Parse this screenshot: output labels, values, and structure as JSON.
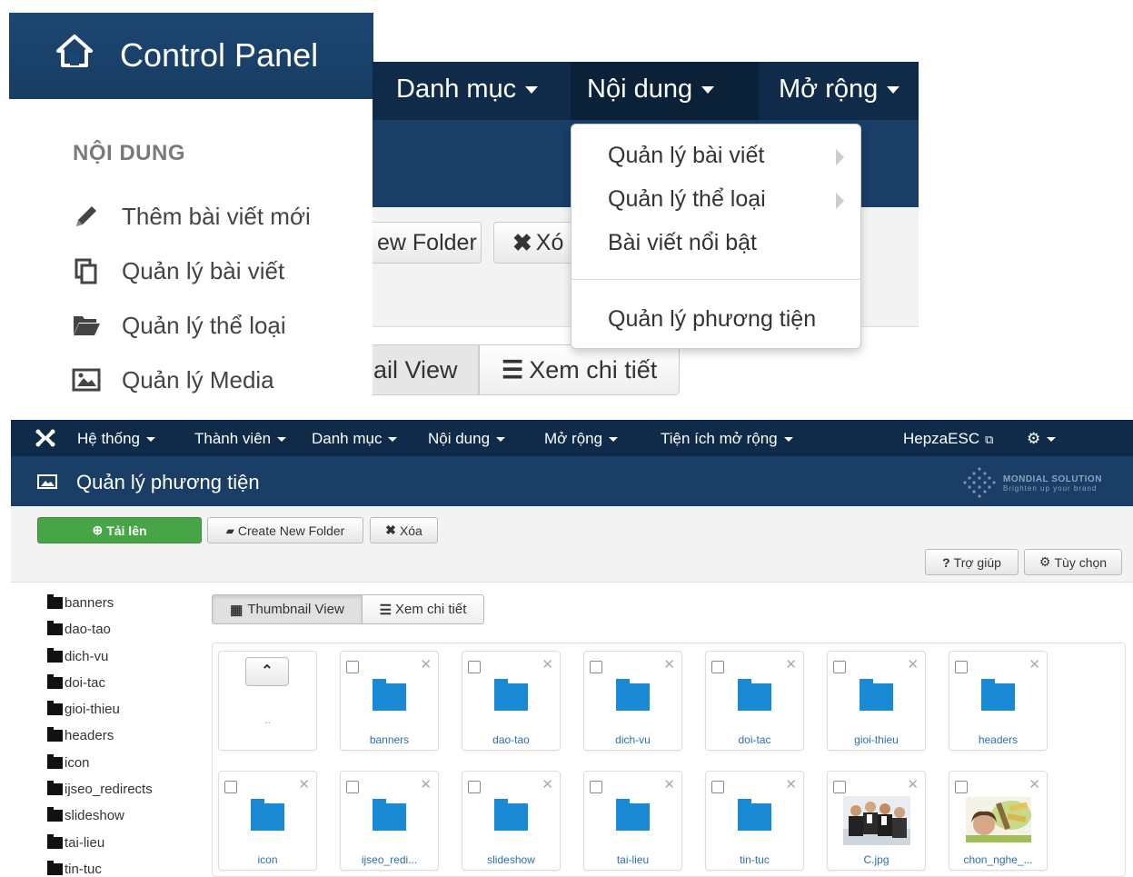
{
  "zoom_panel": {
    "title": "Control Panel",
    "left_menu": {
      "heading": "NỘI DUNG",
      "items": [
        {
          "label": "Thêm bài viết mới",
          "icon": "pencil-icon"
        },
        {
          "label": "Quản lý bài viết",
          "icon": "copy-icon"
        },
        {
          "label": "Quản lý thể loại",
          "icon": "folder-open-icon"
        },
        {
          "label": "Quản lý Media",
          "icon": "picture-icon"
        }
      ]
    },
    "nav": [
      "Danh mục",
      "Nội dung",
      "Mở rộng"
    ],
    "toolbar_fragments": {
      "new_folder": "ew Folder",
      "delete": "Xó"
    },
    "view_fragments": {
      "thumbnail": "ail View",
      "detail": "Xem chi tiết"
    },
    "dropdown": {
      "items": [
        "Quản lý bài viết",
        "Quản lý thể loại",
        "Bài viết nổi bật"
      ],
      "bottom_item": "Quản lý phương tiện"
    }
  },
  "navbar": {
    "items": [
      "Hệ thống",
      "Thành viên",
      "Danh mục",
      "Nội dung",
      "Mở rộng",
      "Tiện ích mở rộng"
    ],
    "site_link": "HepzaESC"
  },
  "page": {
    "title": "Quản lý phương tiện",
    "brand_name": "MONDIAL SOLUTION",
    "brand_tagline": "Brighten up your brand"
  },
  "toolbar": {
    "upload": "Tải lên",
    "new_folder": "Create New Folder",
    "delete": "Xóa",
    "help": "Trợ giúp",
    "options": "Tùy chọn"
  },
  "folder_tree": [
    "banners",
    "dao-tao",
    "dich-vu",
    "doi-tac",
    "gioi-thieu",
    "headers",
    "icon",
    "ijseo_redirects",
    "slideshow",
    "tai-lieu",
    "tin-tuc"
  ],
  "view_toggle": {
    "thumbnail": "Thumbnail View",
    "detail": "Xem chi tiết"
  },
  "media_grid": {
    "up_label": "..",
    "row1": [
      "banners",
      "dao-tao",
      "dich-vu",
      "doi-tac",
      "gioi-thieu",
      "headers"
    ],
    "row2": [
      {
        "label": "icon",
        "type": "folder"
      },
      {
        "label": "ijseo_redi...",
        "type": "folder"
      },
      {
        "label": "slideshow",
        "type": "folder"
      },
      {
        "label": "tai-lieu",
        "type": "folder"
      },
      {
        "label": "tin-tuc",
        "type": "folder"
      },
      {
        "label": "C.jpg",
        "type": "image"
      },
      {
        "label": "chon_nghe_...",
        "type": "image"
      }
    ]
  },
  "colors": {
    "navbar": "#0f2b49",
    "subheader": "#1a3e66",
    "upload_button": "#47a447",
    "folder_icon": "#1a8ad4"
  }
}
